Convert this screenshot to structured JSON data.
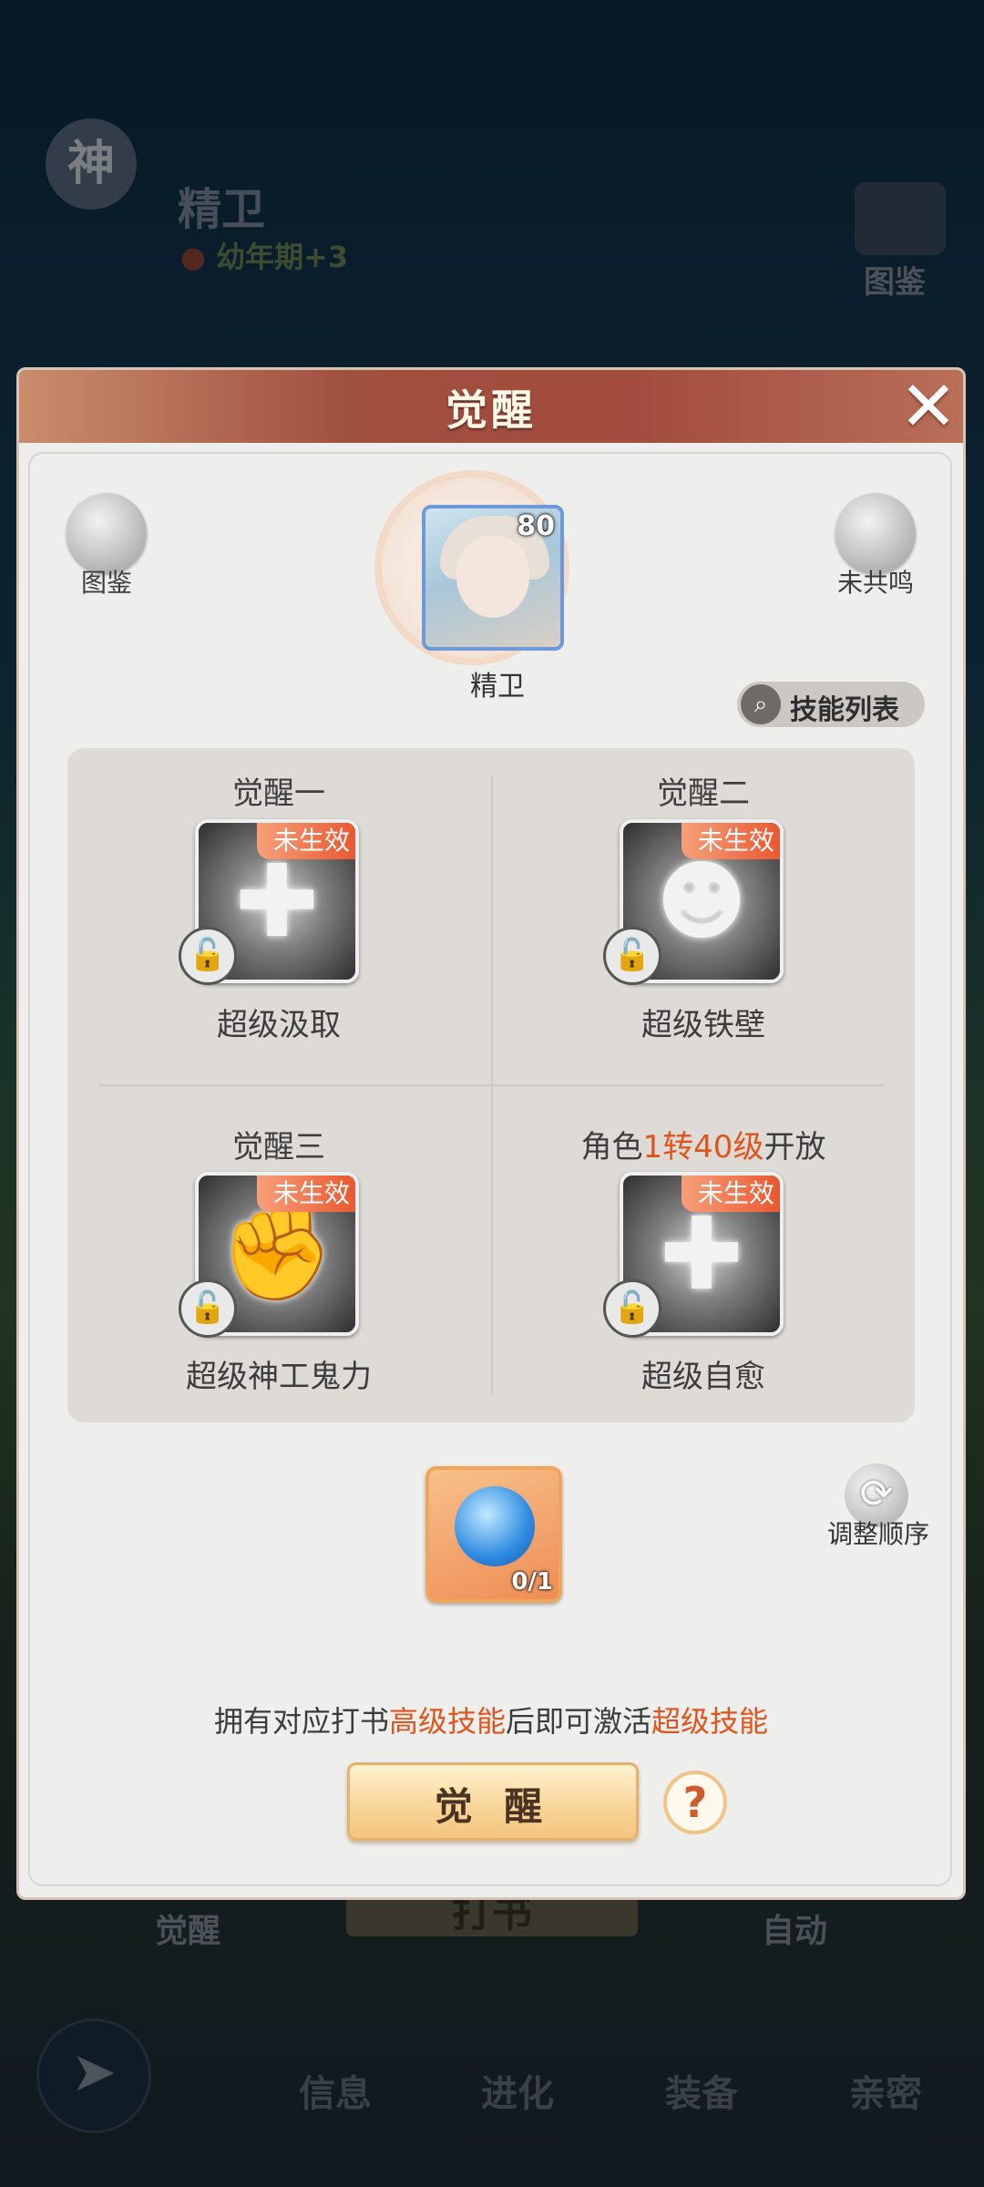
{
  "background": {
    "header_badge": "神",
    "character_name": "精卫",
    "stage": "幼年期+3",
    "codex_label": "图鉴",
    "awaken_label": "觉醒",
    "center_button": "打书",
    "auto_label": "自动",
    "tabs": [
      "信息",
      "进化",
      "装备",
      "亲密"
    ]
  },
  "modal": {
    "title": "觉醒",
    "close_icon": "close-icon",
    "codex_label": "图鉴",
    "resonance_label": "未共鸣",
    "avatar": {
      "level": "80",
      "name": "精卫"
    },
    "skill_list_label": "技能列表",
    "slots": [
      {
        "title": "觉醒一",
        "badge": "未生效",
        "skill": "超级汲取",
        "icon": "sword-plus-icon"
      },
      {
        "title": "觉醒二",
        "badge": "未生效",
        "skill": "超级铁壁",
        "icon": "shield-creature-icon"
      },
      {
        "title": "觉醒三",
        "badge": "未生效",
        "skill": "超级神工鬼力",
        "icon": "fist-icon"
      },
      {
        "title_pre": "角色",
        "title_hl": "1转40级",
        "title_post": "开放",
        "badge": "未生效",
        "skill": "超级自愈",
        "icon": "heal-cross-icon"
      }
    ],
    "item": {
      "count": "0/1"
    },
    "reorder_label": "调整顺序",
    "hint": {
      "p1": "拥有对应打书",
      "hl1": "高级技能",
      "p2": "后即可激活",
      "hl2": "超级技能"
    },
    "awaken_button": "觉 醒",
    "help_icon": "?"
  },
  "colors": {
    "accent": "#e0541e",
    "header": "#a24b3e",
    "badge": "#e9552e"
  }
}
